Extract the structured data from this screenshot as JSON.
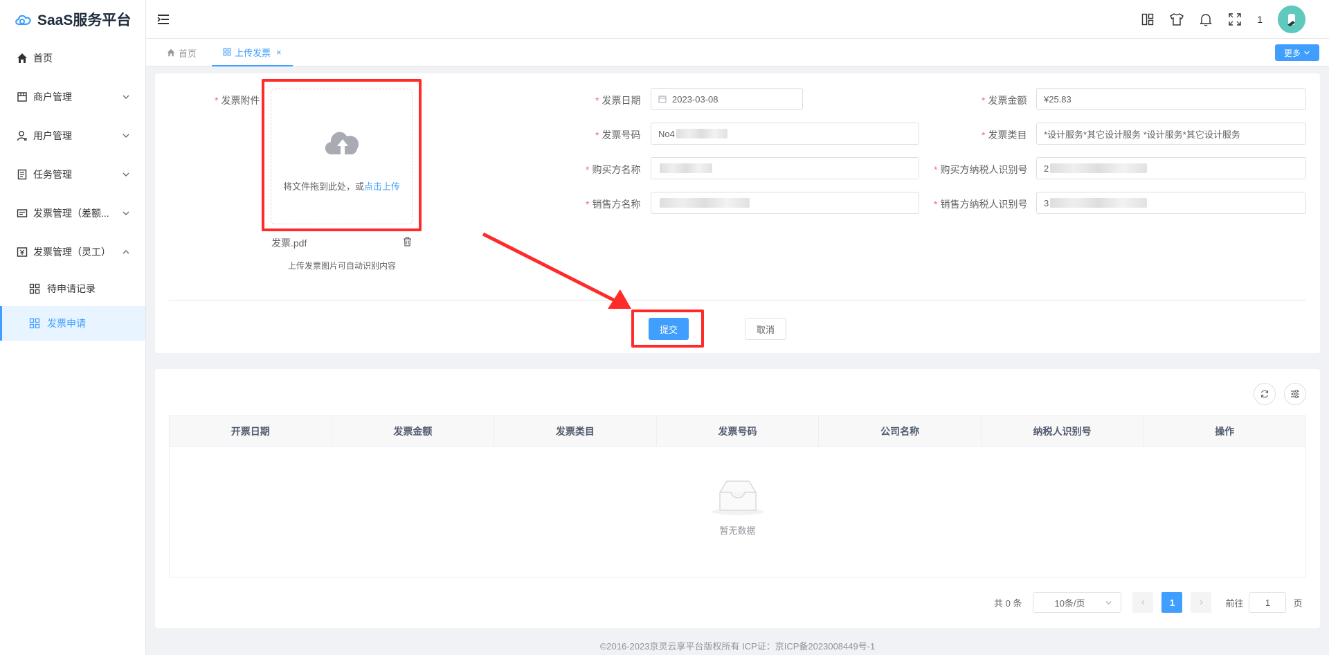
{
  "app": {
    "title": "SaaS服务平台"
  },
  "sidebar": {
    "items": [
      {
        "label": "首页",
        "icon": "home-icon"
      },
      {
        "label": "商户管理",
        "icon": "shop-icon"
      },
      {
        "label": "用户管理",
        "icon": "user-icon"
      },
      {
        "label": "任务管理",
        "icon": "task-icon"
      },
      {
        "label": "发票管理（差额...",
        "icon": "invoice-icon"
      },
      {
        "label": "发票管理（灵工）",
        "icon": "yen-invoice-icon"
      }
    ],
    "subitems": [
      {
        "label": "待申请记录",
        "icon": "grid-icon"
      },
      {
        "label": "发票申请",
        "icon": "grid-icon",
        "active": true
      }
    ]
  },
  "header": {
    "count": "1"
  },
  "tabs": [
    {
      "label": "首页"
    },
    {
      "label": "上传发票",
      "active": true,
      "close": "×"
    }
  ],
  "more_button": "更多",
  "form": {
    "attachment_label": "发票附件",
    "upload_text": "将文件拖到此处，或",
    "upload_link": "点击上传",
    "file_name": "发票.pdf",
    "hint": "上传发票图片可自动识别内容",
    "date_label": "发票日期",
    "date_value": "2023-03-08",
    "amount_label": "发票金额",
    "amount_value": "¥25.83",
    "number_label": "发票号码",
    "number_value": "No4",
    "category_label": "发票类目",
    "category_value": "*设计服务*其它设计服务 *设计服务*其它设计服务",
    "buyer_name_label": "购买方名称",
    "buyer_name_value": "",
    "buyer_tax_label": "购买方纳税人识别号",
    "buyer_tax_value": "2",
    "seller_name_label": "销售方名称",
    "seller_name_value": "",
    "seller_tax_label": "销售方纳税人识别号",
    "seller_tax_value": "3",
    "required_mark": "*",
    "submit": "提交",
    "cancel": "取消"
  },
  "table": {
    "columns": [
      "开票日期",
      "发票金额",
      "发票类目",
      "发票号码",
      "公司名称",
      "纳税人识别号",
      "操作"
    ],
    "empty_text": "暂无数据"
  },
  "pagination": {
    "total": "共 0 条",
    "page_size": "10条/页",
    "prev": "‹",
    "current": "1",
    "next": "›",
    "goto_label": "前往",
    "goto_value": "1",
    "page_suffix": "页"
  },
  "footer": "©2016-2023京灵云享平台版权所有 ICP证：京ICP备2023008449号-1",
  "colors": {
    "primary": "#409eff",
    "highlight": "#ff2a2a"
  }
}
